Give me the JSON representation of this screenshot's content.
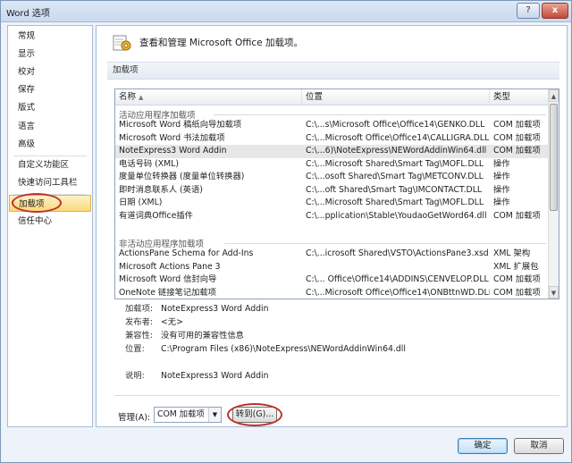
{
  "window": {
    "title": "Word 选项",
    "help_glyph": "?",
    "close_glyph": "x"
  },
  "nav": {
    "items": [
      {
        "label": "常规"
      },
      {
        "label": "显示"
      },
      {
        "label": "校对"
      },
      {
        "label": "保存"
      },
      {
        "label": "版式"
      },
      {
        "label": "语言"
      },
      {
        "label": "高级"
      },
      {
        "label": "自定义功能区"
      },
      {
        "label": "快速访问工具栏"
      },
      {
        "label": "加载项",
        "selected": true
      },
      {
        "label": "信任中心"
      }
    ]
  },
  "content": {
    "header_text": "查看和管理 Microsoft Office 加载项。",
    "section_title": "加载项",
    "columns": {
      "name": "名称",
      "location": "位置",
      "type": "类型"
    },
    "active_group": "活动应用程序加载项",
    "inactive_group": "非活动应用程序加载项",
    "active_rows": [
      {
        "name": "Microsoft Word 稿纸向导加载项",
        "location": "C:\\...s\\Microsoft Office\\Office14\\GENKO.DLL",
        "type": "COM 加载项"
      },
      {
        "name": "Microsoft Word 书法加载项",
        "location": "C:\\...Microsoft Office\\Office14\\CALLIGRA.DLL",
        "type": "COM 加载项"
      },
      {
        "name": "NoteExpress3 Word Addin",
        "location": "C:\\...6)\\NoteExpress\\NEWordAddinWin64.dll",
        "type": "COM 加载项",
        "selected": true
      },
      {
        "name": "电话号码 (XML)",
        "location": "C:\\...Microsoft Shared\\Smart Tag\\MOFL.DLL",
        "type": "操作"
      },
      {
        "name": "度量单位转换器 (度量单位转换器)",
        "location": "C:\\...osoft Shared\\Smart Tag\\METCONV.DLL",
        "type": "操作"
      },
      {
        "name": "即时消息联系人 (英语)",
        "location": "C:\\...oft Shared\\Smart Tag\\IMCONTACT.DLL",
        "type": "操作"
      },
      {
        "name": "日期 (XML)",
        "location": "C:\\...Microsoft Shared\\Smart Tag\\MOFL.DLL",
        "type": "操作"
      },
      {
        "name": "有道词典Office插件",
        "location": "C:\\...pplication\\Stable\\YoudaoGetWord64.dll",
        "type": "COM 加载项"
      }
    ],
    "inactive_rows": [
      {
        "name": "ActionsPane Schema for Add-Ins",
        "location": "C:\\...icrosoft Shared\\VSTO\\ActionsPane3.xsd",
        "type": "XML 架构"
      },
      {
        "name": "Microsoft Actions Pane 3",
        "location": "",
        "type": "XML 扩展包"
      },
      {
        "name": "Microsoft Word 信封向导",
        "location": "C:\\... Office\\Office14\\ADDINS\\CENVELOP.DLL",
        "type": "COM 加载项"
      },
      {
        "name": "OneNote 链接笔记加载项",
        "location": "C:\\...Microsoft Office\\Office14\\ONBttnWD.DLL",
        "type": "COM 加载项"
      }
    ],
    "details": {
      "addin_label": "加载项:",
      "addin_value": "NoteExpress3 Word Addin",
      "publisher_label": "发布者:",
      "publisher_value": "<无>",
      "compat_label": "兼容性:",
      "compat_value": "没有可用的兼容性信息",
      "location_label": "位置:",
      "location_value": "C:\\Program Files (x86)\\NoteExpress\\NEWordAddinWin64.dll",
      "desc_label": "说明:",
      "desc_value": "NoteExpress3 Word Addin"
    },
    "manage": {
      "label": "管理(A):",
      "selected": "COM 加载项",
      "goto_label": "转到(G)..."
    }
  },
  "footer": {
    "ok_label": "确定",
    "cancel_label": "取消"
  },
  "colors": {
    "annotation_ring": "#c0302b",
    "selected_nav": "#fbd97a"
  }
}
